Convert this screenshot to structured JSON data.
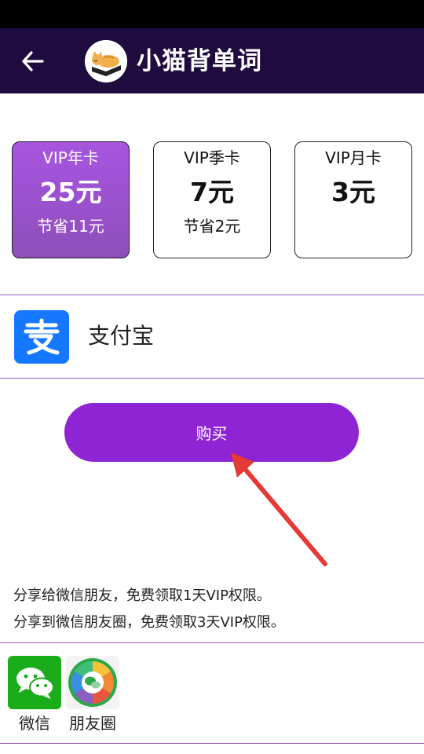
{
  "header": {
    "title": "小猫背单词",
    "back_icon": "arrow-left-icon",
    "logo_icon": "cat-on-book-logo"
  },
  "plans": [
    {
      "name": "VIP年卡",
      "price": "25元",
      "save": "节省11元",
      "selected": true
    },
    {
      "name": "VIP季卡",
      "price": "7元",
      "save": "节省2元",
      "selected": false
    },
    {
      "name": "VIP月卡",
      "price": "3元",
      "save": "",
      "selected": false
    }
  ],
  "payment": {
    "method": "支付宝",
    "icon": "alipay-icon",
    "icon_glyph": "支",
    "color": "#1677ff"
  },
  "buy_button": {
    "label": "购买",
    "color": "#8e24d4"
  },
  "share": {
    "line1": "分享给微信朋友，免费领取1天VIP权限。",
    "line2": "分享到微信朋友圈，免费领取3天VIP权限。",
    "targets": [
      {
        "label": "微信",
        "icon": "wechat-icon"
      },
      {
        "label": "朋友圈",
        "icon": "moments-icon"
      }
    ]
  },
  "colors": {
    "status_bar": "#000000",
    "app_bar": "#1f0b3d",
    "accent": "#8e24d4",
    "selected_card": "#a855e0",
    "divider": "#9b59c9",
    "annotation_arrow": "#e53935"
  }
}
